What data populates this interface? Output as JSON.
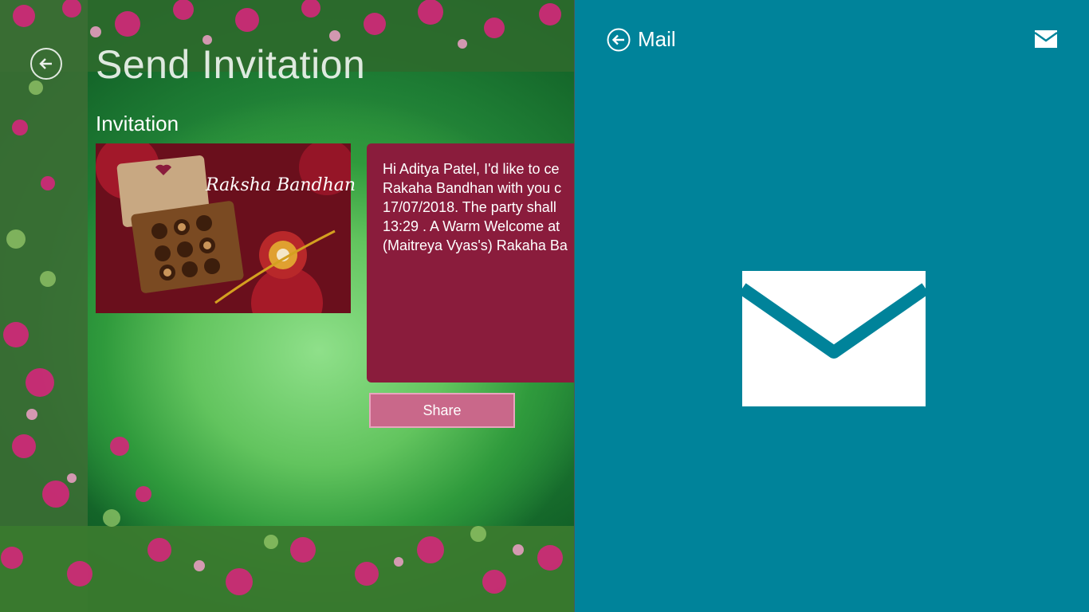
{
  "app": {
    "page_title": "Send Invitation",
    "section_label": "Invitation",
    "card_caption": "Raksha Bandhan",
    "message": "Hi Aditya Patel, I'd like to ce\nRakaha Bandhan with you c\n17/07/2018. The party shall\n13:29 . A Warm Welcome at\n(Maitreya Vyas's) Rakaha Ba",
    "share_label": "Share"
  },
  "mail_pane": {
    "title": "Mail",
    "color": "#00839a"
  }
}
